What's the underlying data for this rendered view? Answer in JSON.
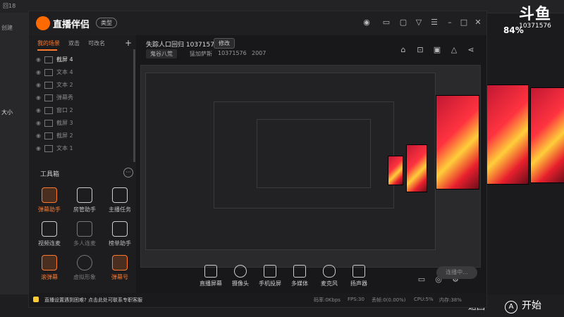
{
  "outer": {
    "top_text": "回18",
    "left_labels": [
      "创建",
      "大小"
    ],
    "logo_mark": "斗鱼",
    "room_id": "10371576",
    "battery_percent": "84%",
    "start_label": "开始",
    "back_label": "返回"
  },
  "window": {
    "app_name": "直播伴侣",
    "theme_label": "类型"
  },
  "sidebar": {
    "tabs": [
      "我的场景",
      "双击",
      "可改名"
    ],
    "scenes": [
      "截屏 4",
      "文本 4",
      "文本 2",
      "弹幕秀",
      "窗口 2",
      "截屏 3",
      "截屏 2",
      "文本 1"
    ],
    "toolbox_title": "工具箱",
    "tools": [
      {
        "label": "弹幕助手",
        "orange": true
      },
      {
        "label": "房管助手",
        "orange": false
      },
      {
        "label": "主播任务",
        "orange": false
      },
      {
        "label": "视频连麦",
        "orange": false
      },
      {
        "label": "多人连麦",
        "orange": false
      },
      {
        "label": "榜单助手",
        "orange": false
      },
      {
        "label": "滚弹幕",
        "orange": true
      },
      {
        "label": "虚拟形象",
        "orange": false
      },
      {
        "label": "弹幕号",
        "orange": true
      }
    ]
  },
  "header": {
    "stream_title": "失踪人口回归 10371576",
    "edit_label": "修改",
    "category": "鬼谷八荒",
    "streamer": "猛加萨斯",
    "room_id": "10371576",
    "heat": "2007"
  },
  "controls": {
    "items": [
      "直播屏幕",
      "摄像头",
      "手机投屏",
      "多媒体",
      "麦克风",
      "扬声器"
    ],
    "start_live": "连播中..."
  },
  "statusbar": {
    "notice": "直播设置遇到困难? 点击此处可联系专职客服",
    "stats": [
      "码率:0Kbps",
      "FPS:30",
      "丢帧:0(0.00%)",
      "CPU:5%",
      "内存:38%"
    ]
  }
}
